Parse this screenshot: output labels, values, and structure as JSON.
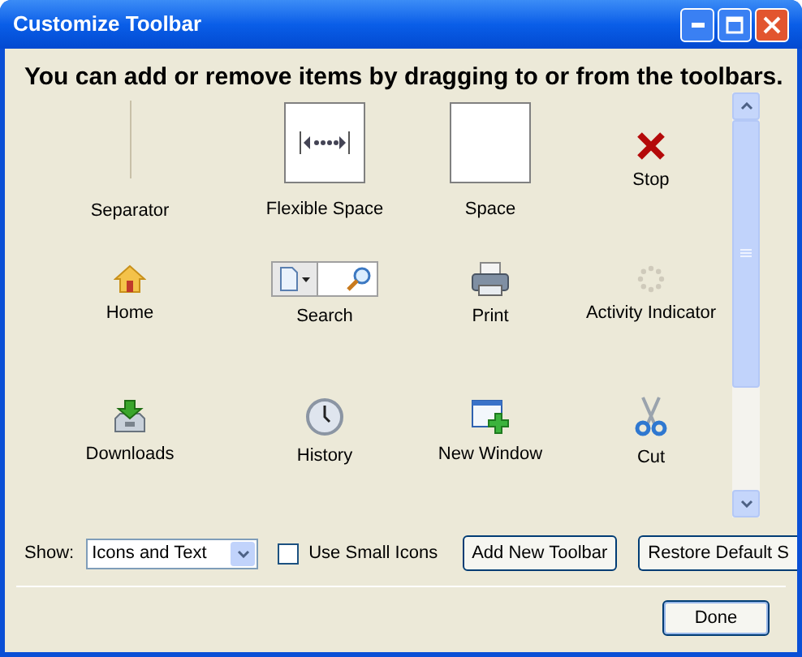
{
  "window": {
    "title": "Customize Toolbar"
  },
  "instructions": "You can add or remove items by dragging to or from the toolbars.",
  "items": [
    {
      "label": "Separator",
      "kind": "separator"
    },
    {
      "label": "Flexible Space",
      "kind": "flexible-space"
    },
    {
      "label": "Space",
      "kind": "space"
    },
    {
      "label": "Stop",
      "kind": "stop"
    },
    {
      "label": "Home",
      "kind": "home"
    },
    {
      "label": "Search",
      "kind": "search"
    },
    {
      "label": "Print",
      "kind": "print"
    },
    {
      "label": "Activity Indicator",
      "kind": "activity"
    },
    {
      "label": "Downloads",
      "kind": "downloads"
    },
    {
      "label": "History",
      "kind": "history"
    },
    {
      "label": "New Window",
      "kind": "new-window"
    },
    {
      "label": "Cut",
      "kind": "cut"
    }
  ],
  "show": {
    "label": "Show:",
    "value": "Icons and Text"
  },
  "small_icons": {
    "label": "Use Small Icons",
    "checked": false
  },
  "buttons": [
    {
      "label": "Add New Toolbar"
    },
    {
      "label": "Restore Default S"
    }
  ],
  "done": {
    "label": "Done"
  }
}
